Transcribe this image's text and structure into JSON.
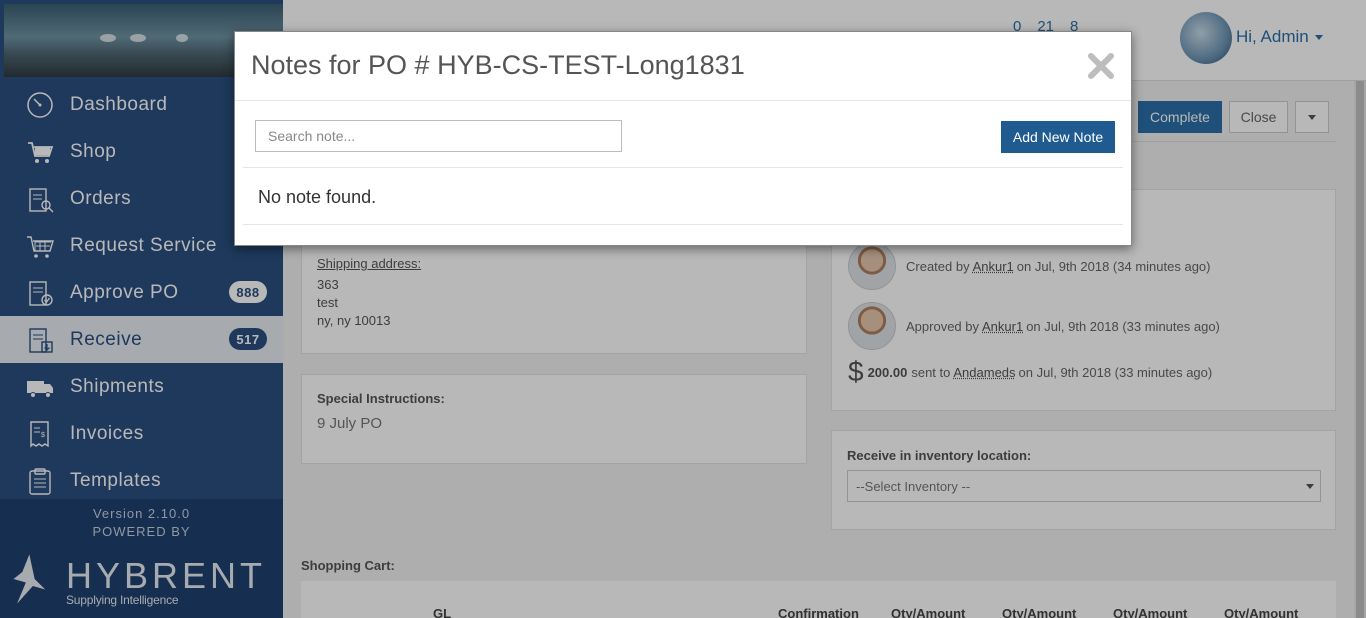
{
  "sidebar": {
    "items": [
      {
        "label": "Dashboard",
        "icon": "dashboard-icon"
      },
      {
        "label": "Shop",
        "icon": "cart-icon"
      },
      {
        "label": "Orders",
        "icon": "orders-icon"
      },
      {
        "label": "Request Service",
        "icon": "request-service-icon"
      },
      {
        "label": "Approve PO",
        "icon": "approve-po-icon",
        "badge": "888"
      },
      {
        "label": "Receive",
        "icon": "receive-icon",
        "badge": "517",
        "active": true
      },
      {
        "label": "Shipments",
        "icon": "truck-icon"
      },
      {
        "label": "Invoices",
        "icon": "invoice-icon"
      },
      {
        "label": "Templates",
        "icon": "templates-icon"
      }
    ],
    "version": "Version 2.10.0",
    "powered_by": "POWERED BY",
    "logo_text": "HYBRENT",
    "logo_tagline": "Supplying Intelligence"
  },
  "header": {
    "counts": [
      "0",
      "21",
      "8"
    ],
    "greeting": "Hi, Admin"
  },
  "toolbar": {
    "complete_label": "Complete",
    "close_label": "Close"
  },
  "address": {
    "label": "Shipping address:",
    "lines": [
      "363",
      "test",
      "ny, ny 10013"
    ]
  },
  "special": {
    "label": "Special Instructions:",
    "value": "9 July PO"
  },
  "history": {
    "created": {
      "prefix": "Created by",
      "user": "Ankur1",
      "suffix": "on Jul, 9th 2018 (34 minutes ago)"
    },
    "approved": {
      "prefix": "Approved by",
      "user": "Ankur1",
      "suffix": "on Jul, 9th 2018 (33 minutes ago)"
    },
    "sent": {
      "dollar": "$",
      "amount": "200.00",
      "prefix": "sent to",
      "vendor": "Andameds",
      "suffix": "on Jul, 9th 2018 (33 minutes ago)"
    }
  },
  "inventory": {
    "label": "Receive in inventory location:",
    "selected": "--Select Inventory --"
  },
  "cart": {
    "label": "Shopping Cart:",
    "columns": [
      "GL",
      "Confirmation",
      "Qty/Amount",
      "Qty/Amount",
      "Qty/Amount",
      "Qty/Amount"
    ]
  },
  "modal": {
    "title": "Notes for PO # HYB-CS-TEST-Long1831",
    "search_placeholder": "Search note...",
    "add_label": "Add New Note",
    "empty_message": "No note found."
  },
  "colors": {
    "sidebar": "#2a4f80",
    "accent": "#1f5b91"
  }
}
